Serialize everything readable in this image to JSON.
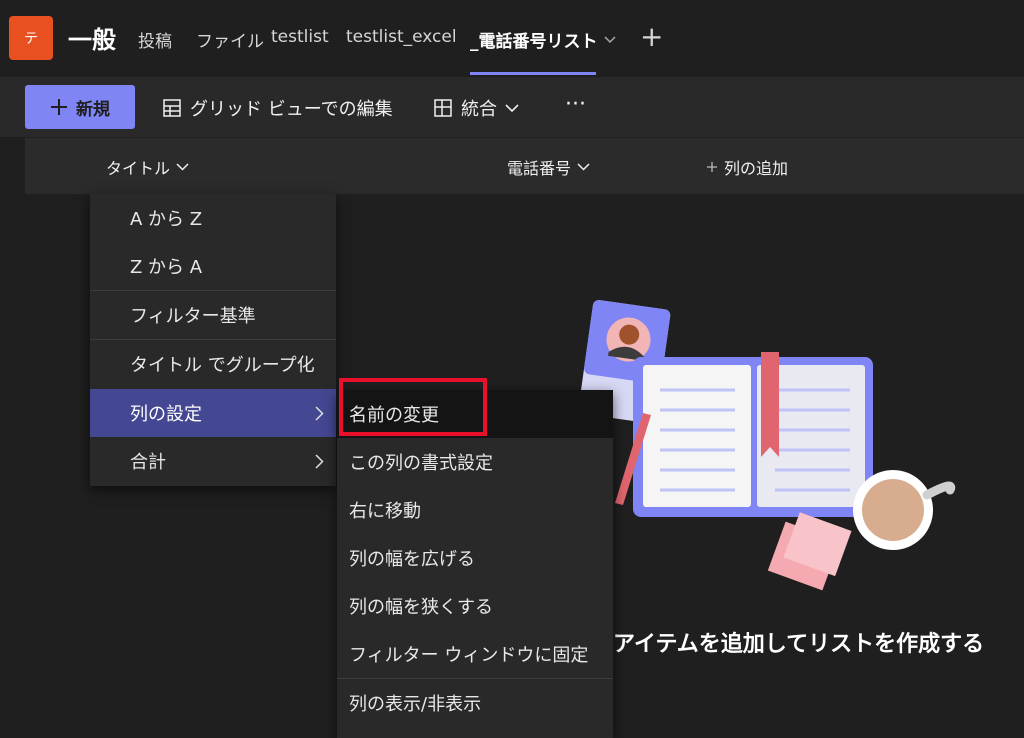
{
  "header": {
    "avatar_initial": "テ",
    "channel_name": "一般",
    "tabs": [
      {
        "label": "投稿"
      },
      {
        "label": "ファイル"
      },
      {
        "label": "testlist"
      },
      {
        "label": "testlist_excel"
      },
      {
        "label": "_電話番号リスト"
      }
    ],
    "add_tab_glyph": "+"
  },
  "toolbar": {
    "new_label": "新規",
    "grid_edit_label": "グリッド ビューでの編集",
    "integrate_label": "統合",
    "more_glyph": "···"
  },
  "columns": {
    "title": "タイトル",
    "phone": "電話番号",
    "add_column": "列の追加"
  },
  "column_menu": {
    "items": [
      {
        "label": "A から Z"
      },
      {
        "label": "Z から A"
      },
      {
        "label": "フィルター基準"
      },
      {
        "label": "タイトル でグループ化"
      },
      {
        "label": "列の設定"
      },
      {
        "label": "合計"
      }
    ]
  },
  "settings_submenu": {
    "items": [
      {
        "label": "名前の変更"
      },
      {
        "label": "この列の書式設定"
      },
      {
        "label": "右に移動"
      },
      {
        "label": "列の幅を広げる"
      },
      {
        "label": "列の幅を狭くする"
      },
      {
        "label": "フィルター ウィンドウに固定"
      },
      {
        "label": "列の表示/非表示"
      }
    ]
  },
  "empty_state": {
    "message": "アイテムを追加してリストを作成する"
  },
  "colors": {
    "accent": "#7f85f5",
    "selected": "#444791",
    "highlight_box": "#e8102a",
    "avatar": "#e8501f"
  },
  "icons": [
    "plus-icon",
    "grid-icon",
    "integrate-icon",
    "chevron-down-icon",
    "chevron-right-icon",
    "more-icon"
  ]
}
